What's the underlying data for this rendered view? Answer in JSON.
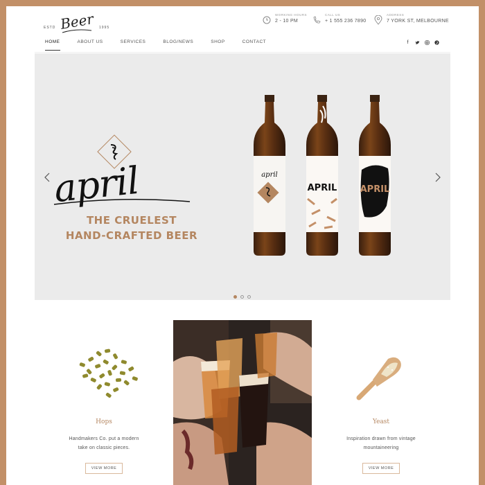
{
  "brand": {
    "est": "ESTD",
    "name": "Beer",
    "year": "1995"
  },
  "header": {
    "hours": {
      "label": "WORKING HOURS",
      "value": "2 - 10 PM"
    },
    "phone": {
      "label": "CALL US",
      "value": "+ 1 555 236 7890"
    },
    "address": {
      "label": "ADDRESS",
      "value": "7 YORK ST, MELBOURNE"
    }
  },
  "nav": {
    "items": [
      "HOME",
      "ABOUT US",
      "SERVICES",
      "BLOG/NEWS",
      "SHOP",
      "CONTACT"
    ],
    "active": "HOME"
  },
  "social": [
    "facebook-icon",
    "twitter-icon",
    "instagram-icon",
    "pinterest-icon"
  ],
  "hero": {
    "script": "april",
    "line1": "THE CRUELEST",
    "line2": "HAND-CRAFTED BEER",
    "bottle_labels": [
      "april",
      "APRIL",
      "APRIL"
    ],
    "slides": 3,
    "active_slide": 1
  },
  "features": [
    {
      "title": "Hops",
      "desc1": "Handmakers Co. put a modern",
      "desc2": "take on classic pieces.",
      "button": "VIEW MORE"
    },
    {
      "title": "Yeast",
      "desc1": "Inspiration drawn from vintage",
      "desc2": "mountaineering",
      "button": "VIEW MORE"
    }
  ],
  "colors": {
    "accent": "#b48660",
    "frame": "#c29068",
    "hero_bg": "#ebebeb"
  }
}
